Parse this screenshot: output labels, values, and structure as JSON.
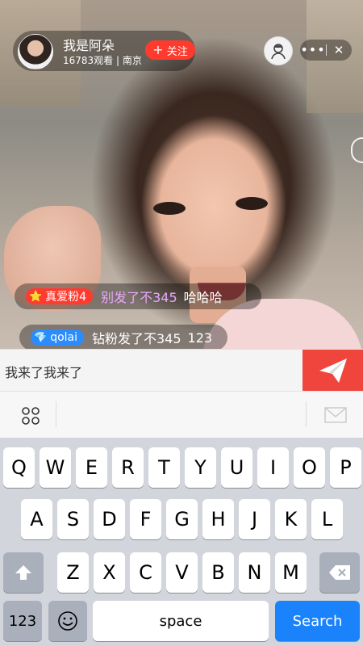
{
  "host": {
    "name": "我是阿朵",
    "stats": "16783观看 | 南京",
    "follow_label": "关注"
  },
  "top_controls": {
    "more_label": "•••",
    "close_label": "✕"
  },
  "messages": [
    {
      "badge": "真爱粉4",
      "badge_icon": "star-icon",
      "name": "别发了不345",
      "text": "哈哈哈"
    },
    {
      "badge": "qolai",
      "badge_icon": "diamond-icon",
      "name": "钻粉发了不345",
      "text": "123"
    }
  ],
  "input": {
    "value": "我来了我来了"
  },
  "keyboard": {
    "row1": [
      "Q",
      "W",
      "E",
      "R",
      "T",
      "Y",
      "U",
      "I",
      "O",
      "P"
    ],
    "row2": [
      "A",
      "S",
      "D",
      "F",
      "G",
      "H",
      "J",
      "K",
      "L"
    ],
    "row3": [
      "Z",
      "X",
      "C",
      "V",
      "B",
      "N",
      "M"
    ],
    "numbers_label": "123",
    "space_label": "space",
    "search_label": "Search"
  },
  "colors": {
    "accent": "#f0453d",
    "follow": "#ff3b30",
    "search_key": "#1a82fb"
  }
}
